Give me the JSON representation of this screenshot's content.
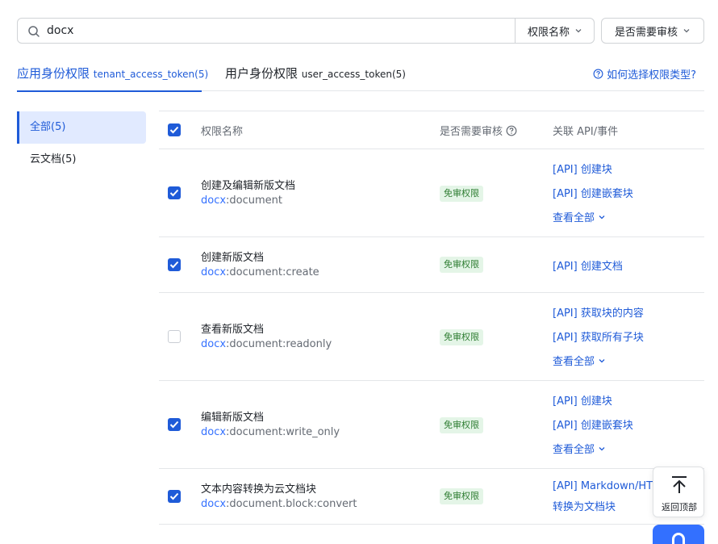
{
  "search": {
    "value": "docx",
    "placeholder": ""
  },
  "filters": {
    "name_select": "权限名称",
    "review_select": "是否需要审核"
  },
  "tabs": [
    {
      "label": "应用身份权限",
      "sub": "tenant_access_token(5)"
    },
    {
      "label": "用户身份权限",
      "sub": "user_access_token(5)"
    }
  ],
  "help_link": "如何选择权限类型?",
  "sidebar": {
    "items": [
      {
        "label": "全部(5)"
      },
      {
        "label": "云文档(5)"
      }
    ]
  },
  "table": {
    "headers": {
      "name": "权限名称",
      "review": "是否需要审核",
      "api": "关联 API/事件"
    },
    "rows": [
      {
        "checked": true,
        "name": "创建及编辑新版文档",
        "code_prefix": "docx",
        "code_rest": ":document",
        "badge": "免审权限",
        "apis": [
          "[API] 创建块",
          "[API] 创建嵌套块"
        ],
        "more": "查看全部"
      },
      {
        "checked": true,
        "name": "创建新版文档",
        "code_prefix": "docx",
        "code_rest": ":document:create",
        "badge": "免审权限",
        "apis": [
          "[API] 创建文档"
        ],
        "more": ""
      },
      {
        "checked": false,
        "name": "查看新版文档",
        "code_prefix": "docx",
        "code_rest": ":document:readonly",
        "badge": "免审权限",
        "apis": [
          "[API] 获取块的内容",
          "[API] 获取所有子块"
        ],
        "more": "查看全部"
      },
      {
        "checked": true,
        "name": "编辑新版文档",
        "code_prefix": "docx",
        "code_rest": ":document:write_only",
        "badge": "免审权限",
        "apis": [
          "[API] 创建块",
          "[API] 创建嵌套块"
        ],
        "more": "查看全部"
      },
      {
        "checked": true,
        "name": "文本内容转换为云文档块",
        "code_prefix": "docx",
        "code_rest": ":document.block:convert",
        "badge": "免审权限",
        "apis": [
          "[API] Markdown/HT",
          "转换为文档块"
        ],
        "more": ""
      }
    ]
  },
  "back_to_top": "返回顶部",
  "colors": {
    "accent": "#1f5bd8",
    "badge_bg": "#e4f5e7",
    "active_bg": "#e1eaff"
  }
}
